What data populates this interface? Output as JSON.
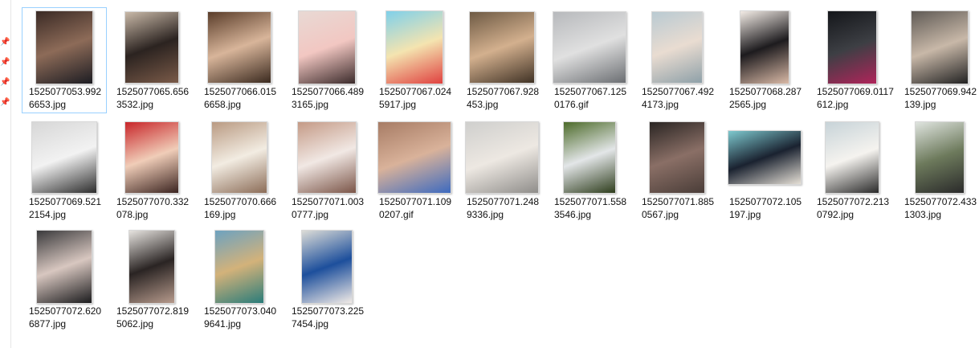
{
  "explorer": {
    "nav_pane": {
      "pins": [
        {
          "icon": "pin-icon"
        },
        {
          "icon": "pin-icon"
        },
        {
          "icon": "pin-icon"
        },
        {
          "icon": "pin-icon"
        }
      ]
    },
    "files": [
      {
        "name": "1525077053.9926653.jpg",
        "selected": true,
        "tones": [
          "#3a2a25",
          "#8d6b58",
          "#1c1c22"
        ]
      },
      {
        "name": "1525077065.6563532.jpg",
        "selected": false,
        "tones": [
          "#c9b9a8",
          "#2b2320",
          "#7a5a48"
        ]
      },
      {
        "name": "1525077066.0156658.jpg",
        "selected": false,
        "tones": [
          "#5a3d2a",
          "#d8b59a",
          "#3b2a1f"
        ]
      },
      {
        "name": "1525077066.4893165.jpg",
        "selected": false,
        "tones": [
          "#e8d9d4",
          "#f2c7c2",
          "#3b2b2b"
        ]
      },
      {
        "name": "1525077067.0245917.jpg",
        "selected": false,
        "tones": [
          "#7fd0ea",
          "#f4e4b0",
          "#e0413f"
        ]
      },
      {
        "name": "1525077067.928453.jpg",
        "selected": false,
        "tones": [
          "#6e5a44",
          "#d3b08e",
          "#403225"
        ]
      },
      {
        "name": "1525077067.1250176.gif",
        "selected": false,
        "tones": [
          "#b7b9bc",
          "#e0e0e0",
          "#6b6e72"
        ]
      },
      {
        "name": "1525077067.4924173.jpg",
        "selected": false,
        "tones": [
          "#b9cad2",
          "#e9dcd1",
          "#8ea0a8"
        ]
      },
      {
        "name": "1525077068.2872565.jpg",
        "selected": false,
        "tones": [
          "#f3ece6",
          "#1d1b1e",
          "#d9b9a6"
        ]
      },
      {
        "name": "1525077069.0117612.jpg",
        "selected": false,
        "tones": [
          "#14161a",
          "#3d3f44",
          "#b0245a"
        ]
      },
      {
        "name": "1525077069.942139.jpg",
        "selected": false,
        "tones": [
          "#5f5a55",
          "#c8b8a8",
          "#222"
        ]
      },
      {
        "name": "1525077069.5212154.jpg",
        "selected": false,
        "tones": [
          "#d7d7d7",
          "#f2f2f2",
          "#2c2c2c"
        ]
      },
      {
        "name": "1525077070.332078.jpg",
        "selected": false,
        "tones": [
          "#c8262a",
          "#f0cdb8",
          "#3b2420"
        ]
      },
      {
        "name": "1525077070.666169.jpg",
        "selected": false,
        "tones": [
          "#b99a82",
          "#f2ece2",
          "#8c6d58"
        ]
      },
      {
        "name": "1525077071.0030777.jpg",
        "selected": false,
        "tones": [
          "#c49a86",
          "#f1e8e4",
          "#7b5548"
        ]
      },
      {
        "name": "1525077071.1090207.gif",
        "selected": false,
        "tones": [
          "#a77c65",
          "#d9b29a",
          "#3d6abf"
        ]
      },
      {
        "name": "1525077071.2489336.jpg",
        "selected": false,
        "tones": [
          "#cfcfcd",
          "#ede8e2",
          "#8f8d8a"
        ]
      },
      {
        "name": "1525077071.5583546.jpg",
        "selected": false,
        "tones": [
          "#4d6b2a",
          "#e3e6e8",
          "#2e3d1c"
        ]
      },
      {
        "name": "1525077071.8850567.jpg",
        "selected": false,
        "tones": [
          "#2a2523",
          "#8a6f66",
          "#4a3d38"
        ]
      },
      {
        "name": "1525077072.105197.jpg",
        "selected": false,
        "tones": [
          "#7ec9cf",
          "#1a2230",
          "#e6e0d6"
        ]
      },
      {
        "name": "1525077072.2130792.jpg",
        "selected": false,
        "tones": [
          "#c7d3d8",
          "#f5f3ef",
          "#2a2a2a"
        ]
      },
      {
        "name": "1525077072.4331303.jpg",
        "selected": false,
        "tones": [
          "#dfe4df",
          "#6d7a5c",
          "#2a2a2a"
        ]
      },
      {
        "name": "1525077072.6206877.jpg",
        "selected": false,
        "tones": [
          "#3a3a3c",
          "#d8c7c0",
          "#1b1b1d"
        ]
      },
      {
        "name": "1525077072.8195062.jpg",
        "selected": false,
        "tones": [
          "#e6e3df",
          "#2a2423",
          "#b69a8c"
        ]
      },
      {
        "name": "1525077073.0409641.jpg",
        "selected": false,
        "tones": [
          "#6da2c0",
          "#d3b27a",
          "#2a7c7a"
        ]
      },
      {
        "name": "1525077073.2257454.jpg",
        "selected": false,
        "tones": [
          "#dcdcd7",
          "#1d4f9c",
          "#f1ebe6"
        ]
      }
    ]
  }
}
